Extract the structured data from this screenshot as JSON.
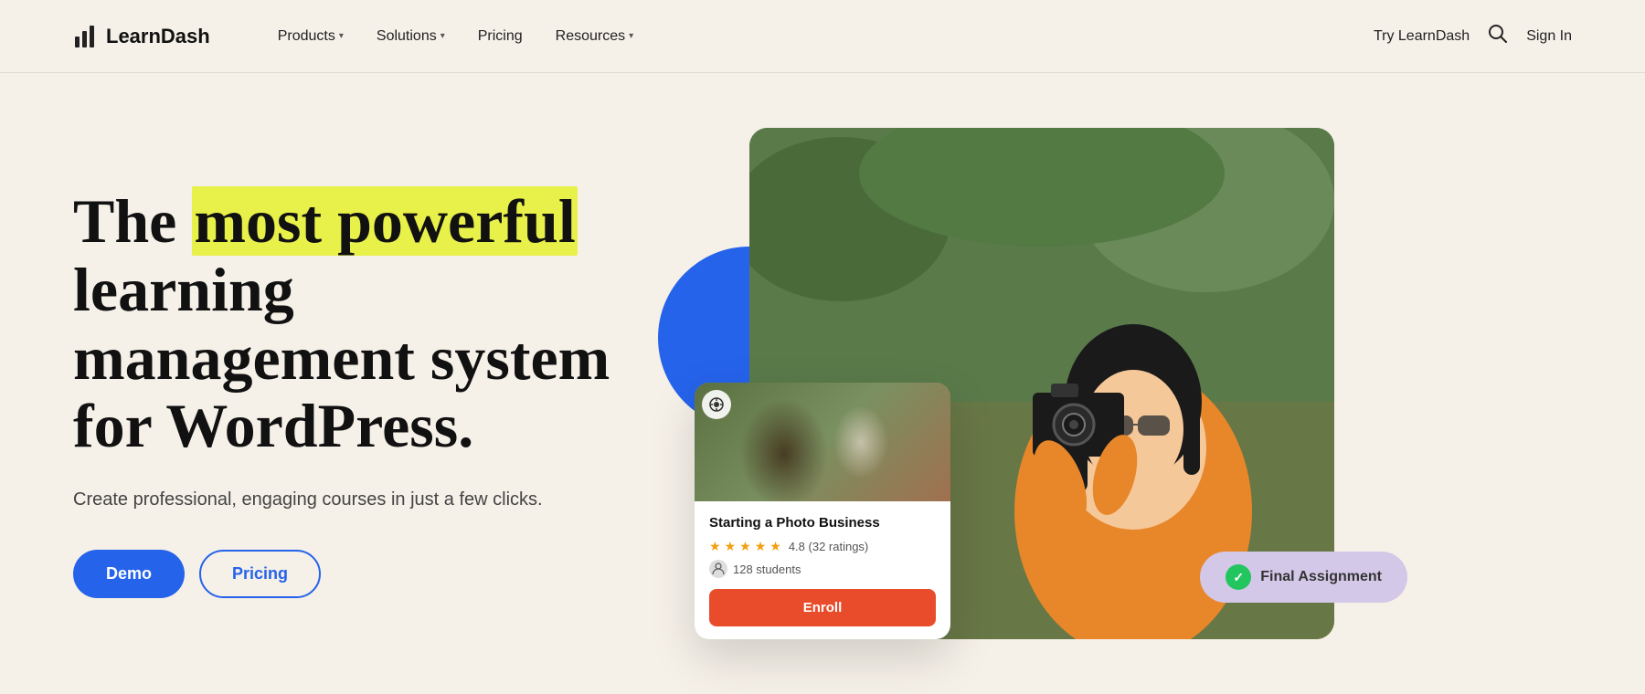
{
  "nav": {
    "logo_text": "LearnDash",
    "logo_icon": "📊",
    "items": [
      {
        "label": "Products",
        "has_chevron": true
      },
      {
        "label": "Solutions",
        "has_chevron": true
      },
      {
        "label": "Pricing",
        "has_chevron": false
      },
      {
        "label": "Resources",
        "has_chevron": true
      }
    ],
    "try_label": "Try LearnDash",
    "signin_label": "Sign In"
  },
  "hero": {
    "title_prefix": "The ",
    "title_highlight": "most powerful",
    "title_suffix": " learning management system for WordPress.",
    "subtitle": "Create professional, engaging courses in just a few clicks.",
    "btn_demo": "Demo",
    "btn_pricing": "Pricing"
  },
  "course_card": {
    "title": "Starting a Photo Business",
    "rating": "4.8",
    "rating_count": "(32 ratings)",
    "students": "128 students",
    "enroll_label": "Enroll",
    "stars": [
      "★",
      "★",
      "★",
      "★",
      "★"
    ]
  },
  "assignment_pill": {
    "label": "Final Assignment",
    "check_icon": "✓"
  }
}
